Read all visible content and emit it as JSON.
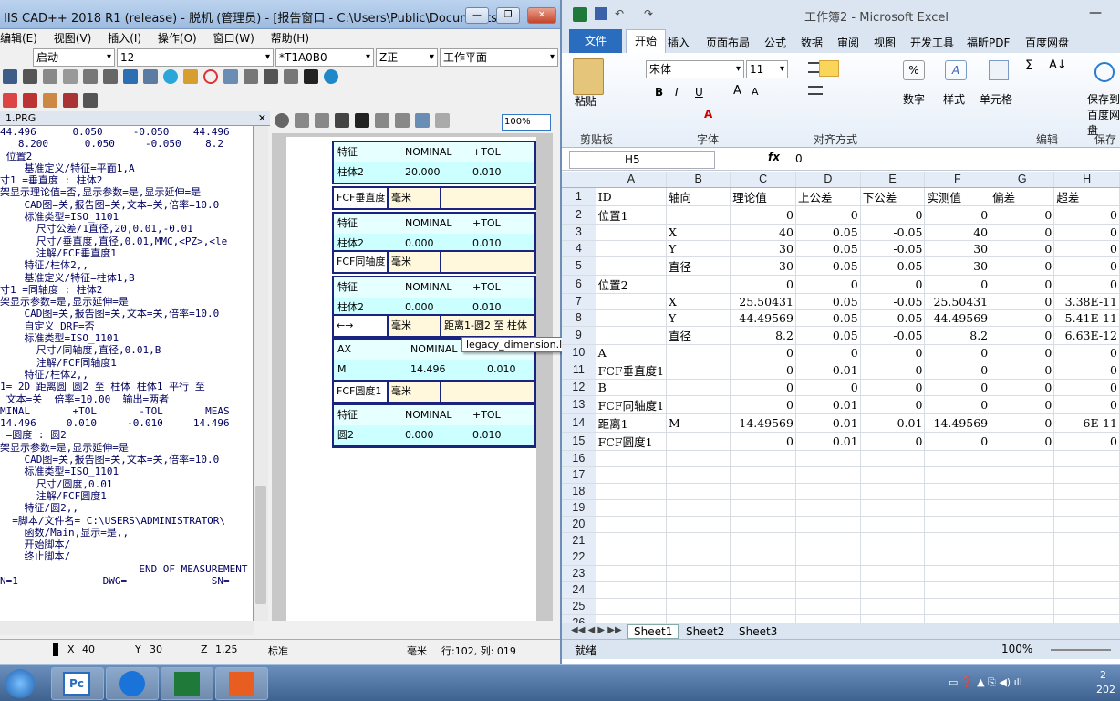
{
  "left": {
    "title": "IIS CAD++ 2018 R1 (release) - 脱机 (管理员) - [报告窗口 - C:\\Users\\Public\\Documents\\...",
    "menu": [
      "编辑(E)",
      "视图(V)",
      "插入(I)",
      "操作(O)",
      "窗口(W)",
      "帮助(H)"
    ],
    "combos": [
      "启动",
      "12",
      "*T1A0B0",
      "Z正",
      "工作平面"
    ],
    "code_tab": "1.PRG",
    "zoom": "100%",
    "code": [
      "44.496      0.050     -0.050    44.496",
      "   8.200      0.050     -0.050    8.2",
      " 位置2",
      "    基准定义/特征=平面1,A",
      "寸1 =垂直度 : 柱体2",
      "架显示理论值=否,显示参数=是,显示延伸=是",
      "    CAD图=关,报告图=关,文本=关,倍率=10.0",
      "    标准类型=ISO_1101",
      "      尺寸公差/1直径,20,0.01,-0.01",
      "      尺寸/垂直度,直径,0.01,MMC,<PZ>,<le",
      "      注解/FCF垂直度1",
      "    特征/柱体2,,",
      "    基准定义/特征=柱体1,B",
      "寸1 =同轴度 : 柱体2",
      "架显示参数=是,显示延伸=是",
      "    CAD图=关,报告图=关,文本=关,倍率=10.0",
      "    自定义 DRF=否",
      "    标准类型=ISO_1101",
      "      尺寸/同轴度,直径,0.01,B",
      "      注解/FCF同轴度1",
      "    特征/柱体2,,",
      "1= 2D 距离圆 圆2 至 柱体 柱体1 平行 至",
      " 文本=关  倍率=10.00  输出=两者",
      "MINAL       +TOL       -TOL       MEAS",
      "14.496     0.010     -0.010     14.496",
      " =圆度 : 圆2",
      "架显示参数=是,显示延伸=是",
      "    CAD图=关,报告图=关,文本=关,倍率=10.0",
      "    标准类型=ISO_1101",
      "      尺寸/圆度,0.01",
      "      注解/FCF圆度1",
      "    特征/圆2,,",
      "  =脚本/文件名= C:\\USERS\\ADMINISTRATOR\\",
      "    函数/Main,显示=是,,",
      "    开始脚本/",
      "    终止脚本/",
      "                       END OF MEASUREMENT",
      "N=1              DWG=              SN="
    ],
    "report": {
      "t1": {
        "h": [
          "特征",
          "NOMINAL",
          "+TOL"
        ],
        "r": [
          "柱体2",
          "20.000",
          "0.010"
        ]
      },
      "f1": [
        "FCF垂直度",
        "毫米",
        ""
      ],
      "t2": {
        "h": [
          "特征",
          "NOMINAL",
          "+TOL"
        ],
        "r": [
          "柱体2",
          "0.000",
          "0.010"
        ]
      },
      "f2": [
        "FCF同轴度",
        "毫米",
        ""
      ],
      "t3": {
        "h": [
          "特征",
          "NOMINAL",
          "+TOL"
        ],
        "r": [
          "柱体2",
          "0.000",
          "0.010"
        ]
      },
      "f3": [
        "←→",
        "毫米",
        "距离1-圆2 至 柱体"
      ],
      "t4": {
        "h": [
          "AX",
          "NOMINAL",
          "+TOL"
        ],
        "r": [
          "M",
          "14.496",
          "0.010"
        ]
      },
      "f4": [
        "FCF圆度1",
        "毫米",
        ""
      ],
      "t5": {
        "h": [
          "特征",
          "NOMINAL",
          "+TOL"
        ],
        "r": [
          "圆2",
          "0.000",
          "0.010"
        ]
      }
    },
    "tooltip": "legacy_dimension.lbl",
    "status": {
      "x_label": "X",
      "x": "40",
      "y_label": "Y",
      "y": "30",
      "z_label": "Z",
      "z": "1.25",
      "mode": "标准",
      "unit": "毫米",
      "pos": "行:102, 列: 019"
    }
  },
  "excel": {
    "title": "工作簿2 - Microsoft Excel",
    "tabs": [
      "文件",
      "开始",
      "插入",
      "页面布局",
      "公式",
      "数据",
      "审阅",
      "视图",
      "开发工具",
      "福昕PDF",
      "百度网盘"
    ],
    "font": "宋体",
    "size": "11",
    "groups": [
      "剪贴板",
      "字体",
      "对齐方式",
      "数字",
      "样式",
      "单元格",
      "编辑",
      "保存"
    ],
    "buttons": [
      "粘贴",
      "数字",
      "样式",
      "单元格",
      "保存到百度网盘"
    ],
    "namebox": "H5",
    "formula": "0",
    "cols": [
      "A",
      "B",
      "C",
      "D",
      "E",
      "F",
      "G",
      "H"
    ],
    "rows": [
      [
        "ID",
        "轴向",
        "理论值",
        "上公差",
        "下公差",
        "实测值",
        "偏差",
        "超差"
      ],
      [
        "位置1",
        "",
        "0",
        "0",
        "0",
        "0",
        "0",
        "0"
      ],
      [
        "",
        "X",
        "40",
        "0.05",
        "-0.05",
        "40",
        "0",
        "0"
      ],
      [
        "",
        "Y",
        "30",
        "0.05",
        "-0.05",
        "30",
        "0",
        "0"
      ],
      [
        "",
        "直径",
        "30",
        "0.05",
        "-0.05",
        "30",
        "0",
        "0"
      ],
      [
        "位置2",
        "",
        "0",
        "0",
        "0",
        "0",
        "0",
        "0"
      ],
      [
        "",
        "X",
        "25.50431",
        "0.05",
        "-0.05",
        "25.50431",
        "0",
        "3.38E-11"
      ],
      [
        "",
        "Y",
        "44.49569",
        "0.05",
        "-0.05",
        "44.49569",
        "0",
        "5.41E-11"
      ],
      [
        "",
        "直径",
        "8.2",
        "0.05",
        "-0.05",
        "8.2",
        "0",
        "6.63E-12"
      ],
      [
        "A",
        "",
        "0",
        "0",
        "0",
        "0",
        "0",
        "0"
      ],
      [
        "FCF垂直度1",
        "",
        "0",
        "0.01",
        "0",
        "0",
        "0",
        "0"
      ],
      [
        "B",
        "",
        "0",
        "0",
        "0",
        "0",
        "0",
        "0"
      ],
      [
        "FCF同轴度1",
        "",
        "0",
        "0.01",
        "0",
        "0",
        "0",
        "0"
      ],
      [
        "距离1",
        "M",
        "14.49569",
        "0.01",
        "-0.01",
        "14.49569",
        "0",
        "-6E-11"
      ],
      [
        "FCF圆度1",
        "",
        "0",
        "0.01",
        "0",
        "0",
        "0",
        "0"
      ],
      [
        "",
        "",
        "",
        "",
        "",
        "",
        "",
        ""
      ],
      [
        "",
        "",
        "",
        "",
        "",
        "",
        "",
        ""
      ],
      [
        "",
        "",
        "",
        "",
        "",
        "",
        "",
        ""
      ],
      [
        "",
        "",
        "",
        "",
        "",
        "",
        "",
        ""
      ],
      [
        "",
        "",
        "",
        "",
        "",
        "",
        "",
        ""
      ],
      [
        "",
        "",
        "",
        "",
        "",
        "",
        "",
        ""
      ],
      [
        "",
        "",
        "",
        "",
        "",
        "",
        "",
        ""
      ],
      [
        "",
        "",
        "",
        "",
        "",
        "",
        "",
        ""
      ],
      [
        "",
        "",
        "",
        "",
        "",
        "",
        "",
        ""
      ],
      [
        "",
        "",
        "",
        "",
        "",
        "",
        "",
        ""
      ],
      [
        "",
        "",
        "",
        "",
        "",
        "",
        "",
        ""
      ]
    ],
    "sheets": [
      "Sheet1",
      "Sheet2",
      "Sheet3"
    ],
    "status": "就绪",
    "zoom": "100%"
  },
  "taskbar": {
    "time": "2",
    "date": "202"
  }
}
